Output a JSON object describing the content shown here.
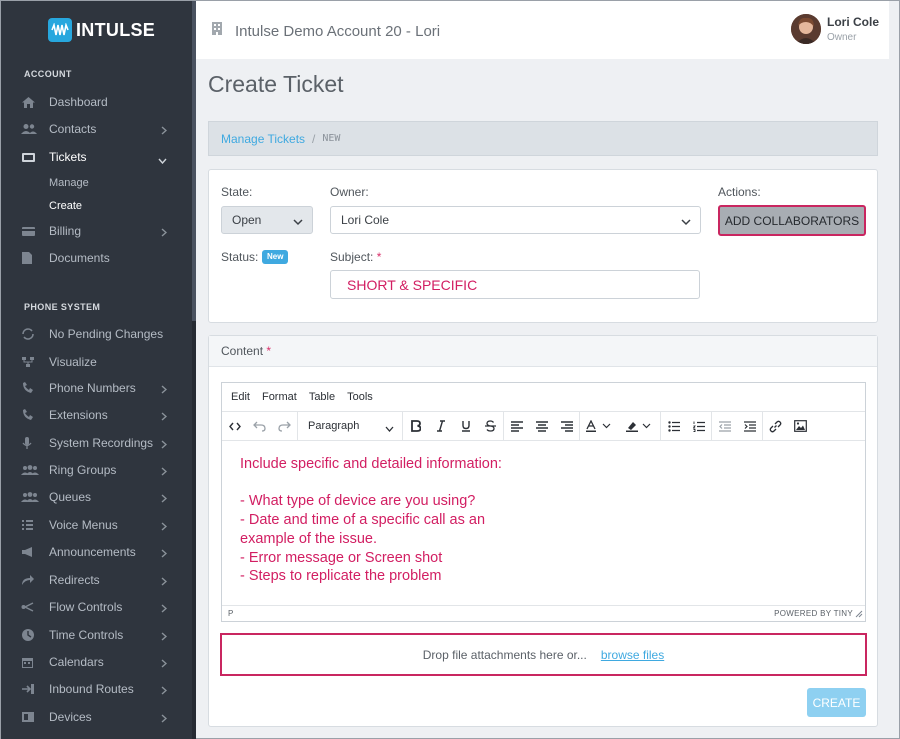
{
  "brand": {
    "name": "INTULSE"
  },
  "sidebar": {
    "sections": {
      "account": "ACCOUNT",
      "phone_system": "PHONE SYSTEM"
    },
    "account_items": [
      {
        "label": "Dashboard",
        "icon": "home-icon"
      },
      {
        "label": "Contacts",
        "icon": "contacts-icon"
      },
      {
        "label": "Tickets",
        "icon": "ticket-icon"
      },
      {
        "label": "Billing",
        "icon": "card-icon"
      },
      {
        "label": "Documents",
        "icon": "document-icon"
      }
    ],
    "tickets_sub": [
      {
        "label": "Manage"
      },
      {
        "label": "Create"
      }
    ],
    "phone_items": [
      {
        "label": "No Pending Changes"
      },
      {
        "label": "Visualize"
      },
      {
        "label": "Phone Numbers"
      },
      {
        "label": "Extensions"
      },
      {
        "label": "System Recordings"
      },
      {
        "label": "Ring Groups"
      },
      {
        "label": "Queues"
      },
      {
        "label": "Voice Menus"
      },
      {
        "label": "Announcements"
      },
      {
        "label": "Redirects"
      },
      {
        "label": "Flow Controls"
      },
      {
        "label": "Time Controls"
      },
      {
        "label": "Calendars"
      },
      {
        "label": "Inbound Routes"
      },
      {
        "label": "Devices"
      }
    ]
  },
  "header": {
    "account": "Intulse Demo Account 20 - Lori",
    "user_name": "Lori Cole",
    "user_role": "Owner"
  },
  "page": {
    "title": "Create Ticket"
  },
  "breadcrumb": {
    "link": "Manage Tickets",
    "separator": "/",
    "current": "NEW"
  },
  "form": {
    "state_label": "State:",
    "state_value": "Open",
    "owner_label": "Owner:",
    "owner_value": "Lori Cole",
    "actions_label": "Actions:",
    "collab_button": "ADD COLLABORATORS",
    "status_label": "Status:",
    "status_badge": "New",
    "subject_label": "Subject:",
    "subject_value": "SHORT & SPECIFIC",
    "required_mark": "*"
  },
  "content": {
    "label": "Content",
    "menu": [
      "Edit",
      "Format",
      "Table",
      "Tools"
    ],
    "block_format": "Paragraph",
    "lines": [
      "Include specific and detailed information:",
      "",
      "- What type of device are you using?",
      "- Date and time of a specific call as an",
      "example of the issue.",
      "- Error message or Screen shot",
      "- Steps to replicate the problem"
    ],
    "status_path": "P",
    "powered_by": "POWERED BY TINY"
  },
  "attachments": {
    "text": "Drop file attachments here or...",
    "browse": "browse files"
  },
  "create_button": "CREATE"
}
